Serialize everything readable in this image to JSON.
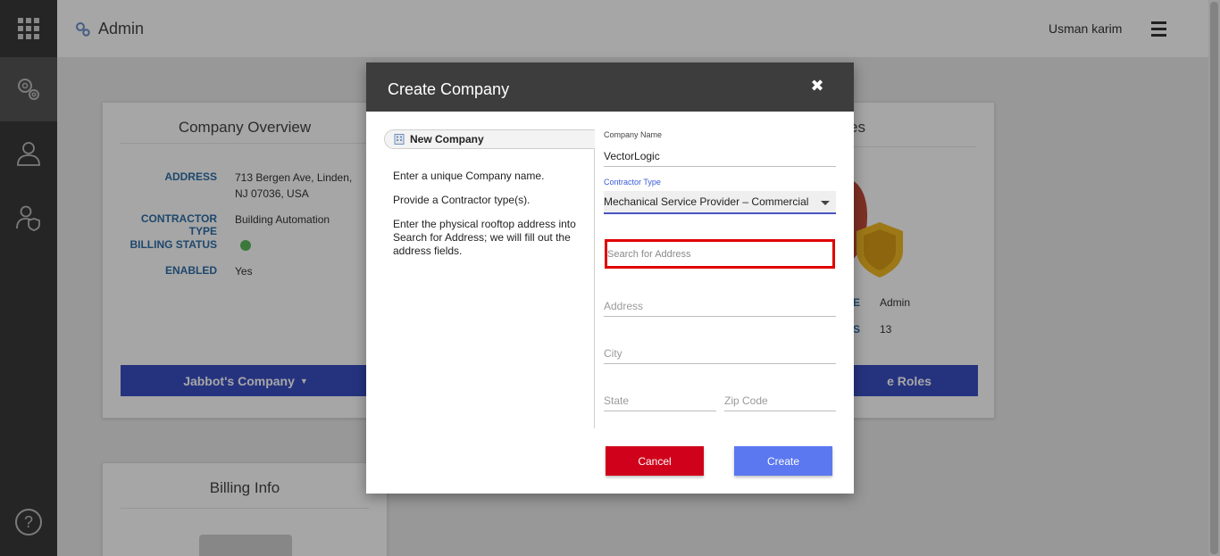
{
  "app": {
    "title": "Admin",
    "user_name": "Usman karim"
  },
  "rail": {
    "items": [
      {
        "icon": "settings-gear-icon"
      },
      {
        "icon": "users-icon"
      },
      {
        "icon": "user-shield-icon"
      }
    ],
    "help_glyph": "?"
  },
  "overview": {
    "title": "Company Overview",
    "rows": [
      {
        "key": "ADDRESS",
        "value": "713 Bergen Ave, Linden, NJ 07036, USA"
      },
      {
        "key": "CONTRACTOR TYPE",
        "value": "Building Automation"
      },
      {
        "key": "BILLING STATUS",
        "value": ""
      },
      {
        "key": "ENABLED",
        "value": "Yes"
      }
    ],
    "company_button": "Jabbot's Company",
    "billing_status_color": "#5cb85c"
  },
  "roles_card": {
    "title_fragment": "es",
    "role_key_fragment": "E",
    "role_value": "Admin",
    "count_key_fragment": "S",
    "count_value": "13",
    "button_fragment": "e Roles"
  },
  "billing": {
    "title": "Billing Info"
  },
  "modal": {
    "title": "Create Company",
    "close_glyph": "✖",
    "step_tab": "New Company",
    "instructions": [
      "Enter a unique Company name.",
      "Provide a Contractor type(s).",
      "Enter the physical rooftop address into Search for Address; we will fill out the address fields."
    ],
    "company_name_label": "Company Name",
    "company_name_value": "VectorLogic",
    "contractor_type_label": "Contractor Type",
    "contractor_type_value": "Mechanical Service Provider – Commercial",
    "search_placeholder": "Search for Address",
    "address_placeholder": "Address",
    "city_placeholder": "City",
    "state_placeholder": "State",
    "zip_placeholder": "Zip Code",
    "cancel_label": "Cancel",
    "create_label": "Create"
  },
  "colors": {
    "accent_blue": "#3a4fc4",
    "cancel_red": "#d0021b",
    "create_blue": "#5b78f0",
    "highlight_red": "#e00000"
  }
}
